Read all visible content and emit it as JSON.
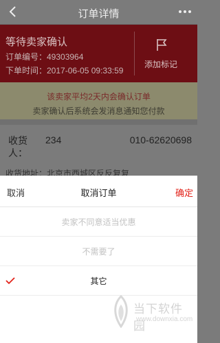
{
  "nav": {
    "title": "订单详情"
  },
  "banner": {
    "status": "等待卖家确认",
    "order_no": "订单编号：49303964",
    "order_time": "下单时间：2017-06-05 09:33:59",
    "mark_label": "添加标记"
  },
  "notice": {
    "line1": "该卖家平均2天内会确认订单",
    "line2": "卖家确认后系统会发消息通知您付款"
  },
  "receiver": {
    "label": "收货人：",
    "name": "234",
    "phone": "010-62620698",
    "address": "收货地址：北京市西城区反反复复"
  },
  "sheet": {
    "cancel_label": "取消",
    "title": "取消订单",
    "confirm_label": "确定",
    "options": [
      {
        "label": "卖家不同意适当优惠",
        "selected": false
      },
      {
        "label": "不需要了",
        "selected": false
      },
      {
        "label": "其它",
        "selected": true
      }
    ]
  },
  "watermark": {
    "name": "当下软件园",
    "url": "www.downxia.com"
  },
  "colors": {
    "accent": "#e2231a",
    "banner": "#6d0e14"
  }
}
